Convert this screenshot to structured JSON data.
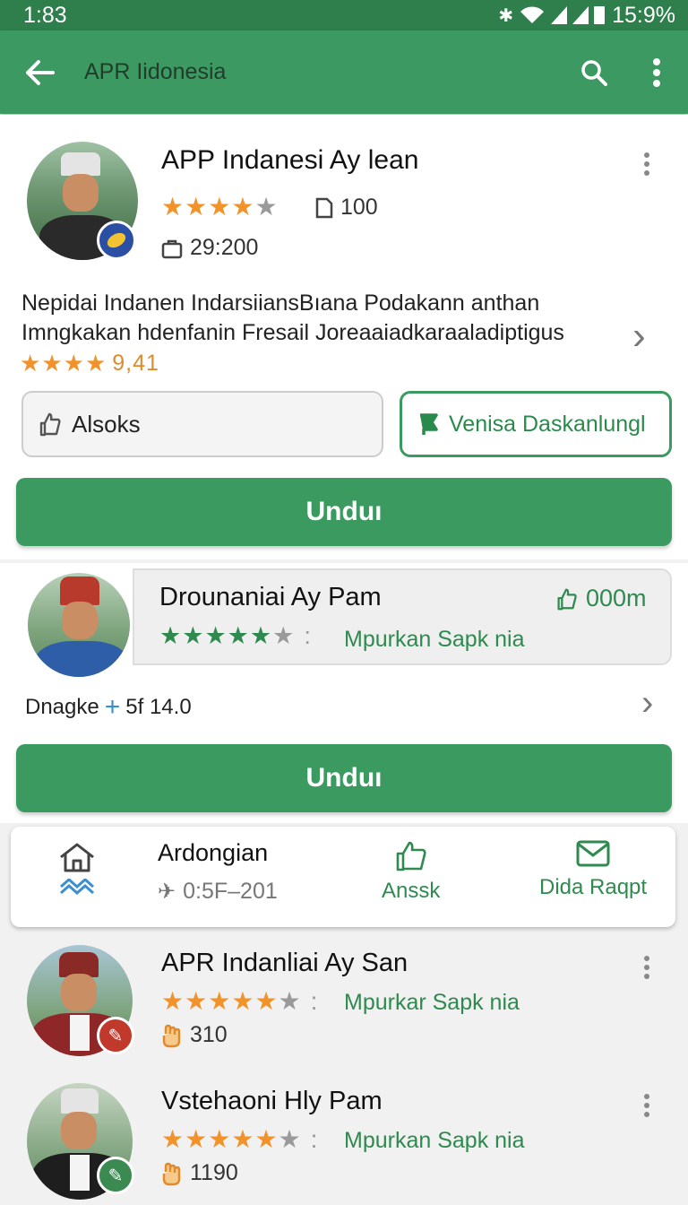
{
  "status_bar": {
    "time": "1:83",
    "battery": "15:9%"
  },
  "app_bar": {
    "title": "APR Iidonesia",
    "icons": [
      "back-arrow-icon",
      "search-icon",
      "more-vert-icon"
    ]
  },
  "featured": {
    "name": "APP Indanesi Ay lean",
    "rating_stars": 4,
    "count": "100",
    "time": "29:200",
    "description": "Nepidai Indanen IndarsiiansBıana Podakann  anthan Imngkakan hdenfanin Fresail Joreaaiadkaraaladiptigus",
    "small_rating": "9,41",
    "btn_secondary": "Alsoks",
    "btn_outline_green": "Venisa Daskanlungl",
    "btn_primary": "Unduı"
  },
  "second": {
    "name": "Drounaniai Ay Pam",
    "distance": "000m",
    "rating_stars": 5,
    "tag": "Mpurkan Sapk nia",
    "footer_label": "Dnagke",
    "footer_value": "5f 14.0",
    "btn_primary": "Unduı"
  },
  "quickbar": {
    "title": "Ardongian",
    "subtitle": "0:5F–201",
    "action1": "Anssk",
    "action2": "Dida Raqpt"
  },
  "list": [
    {
      "name": "APR Indanliai Ay San",
      "rating_stars": 5,
      "tag": "Mpurkar Sapk nia",
      "count": "310"
    },
    {
      "name": "Vstehaoni Hly Pam",
      "rating_stars": 5,
      "tag": "Mpurkan Sapk nia",
      "count": "1190"
    }
  ],
  "colors": {
    "primary": "#3a9a5f",
    "app_bar": "#3d9962",
    "status_bar": "#2f7f4c",
    "star": "#f2922b"
  }
}
